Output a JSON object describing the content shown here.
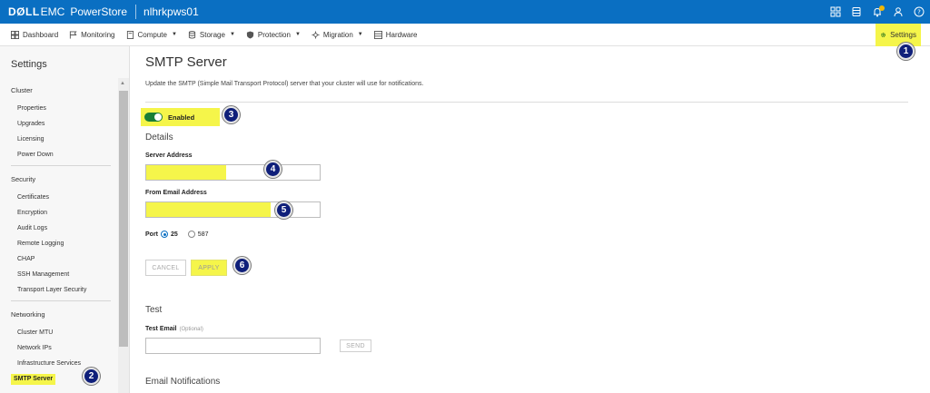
{
  "header": {
    "brand_dell": "DØLL",
    "brand_emc": "EMC",
    "product": "PowerStore",
    "cluster": "nlhrkpws01",
    "icons": [
      "grid-icon",
      "database-icon",
      "bell-icon",
      "user-icon",
      "help-icon"
    ],
    "accent": "#0a6fc2"
  },
  "nav": {
    "items": [
      {
        "label": "Dashboard",
        "icon": "dashboard-icon",
        "dropdown": false
      },
      {
        "label": "Monitoring",
        "icon": "flag-icon",
        "dropdown": false
      },
      {
        "label": "Compute",
        "icon": "compute-icon",
        "dropdown": true
      },
      {
        "label": "Storage",
        "icon": "storage-icon",
        "dropdown": true
      },
      {
        "label": "Protection",
        "icon": "shield-icon",
        "dropdown": true
      },
      {
        "label": "Migration",
        "icon": "migration-icon",
        "dropdown": true
      },
      {
        "label": "Hardware",
        "icon": "hardware-icon",
        "dropdown": false
      }
    ],
    "settings_label": "Settings"
  },
  "sidebar": {
    "title": "Settings",
    "sections": [
      {
        "name": "Cluster",
        "items": [
          "Properties",
          "Upgrades",
          "Licensing",
          "Power Down"
        ]
      },
      {
        "name": "Security",
        "items": [
          "Certificates",
          "Encryption",
          "Audit Logs",
          "Remote Logging",
          "CHAP",
          "SSH Management",
          "Transport Layer Security"
        ]
      },
      {
        "name": "Networking",
        "items": [
          "Cluster MTU",
          "Network IPs",
          "Infrastructure Services",
          "SMTP Server"
        ]
      }
    ],
    "active_item": "SMTP Server"
  },
  "main": {
    "title": "SMTP Server",
    "description": "Update the SMTP (Simple Mail Transport Protocol) server that your cluster will use for notifications.",
    "toggle_label": "Enabled",
    "details_heading": "Details",
    "server_address_label": "Server Address",
    "server_address_value": "",
    "from_email_label": "From Email Address",
    "from_email_value": "",
    "port_label": "Port",
    "port_options": [
      "25",
      "587"
    ],
    "port_selected": "25",
    "cancel_label": "CANCEL",
    "apply_label": "APPLY",
    "test_heading": "Test",
    "test_email_label": "Test Email",
    "test_email_optional": "(Optional)",
    "send_label": "SEND",
    "email_notifications_heading": "Email Notifications"
  },
  "callouts": [
    "1",
    "2",
    "3",
    "4",
    "5",
    "6"
  ],
  "highlight_color": "#f5f54a"
}
